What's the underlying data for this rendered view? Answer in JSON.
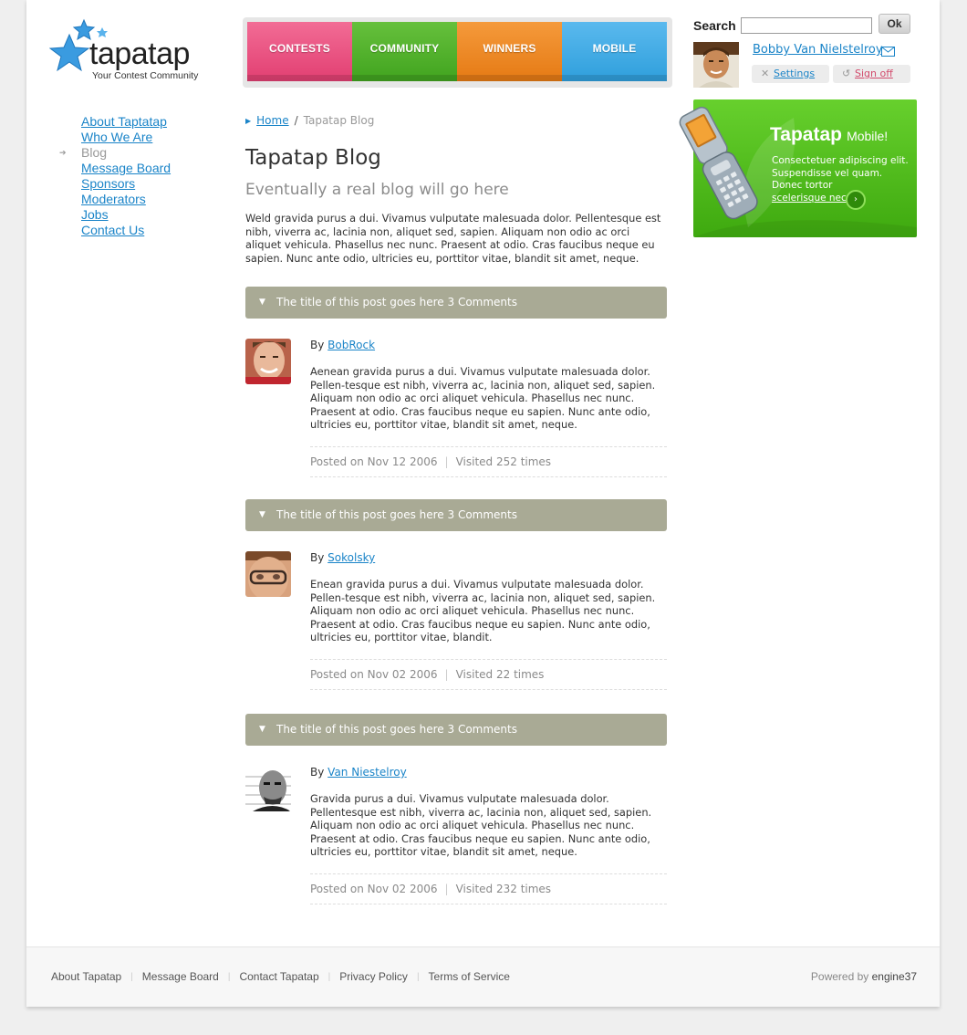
{
  "logo": {
    "word": "tapatap",
    "tagline": "Your Contest Community"
  },
  "nav": {
    "tabs": [
      {
        "label": "CONTESTS",
        "color": "#e8497b"
      },
      {
        "label": "COMMUNITY",
        "color": "#4fb02a"
      },
      {
        "label": "WINNERS",
        "color": "#ee8a23"
      },
      {
        "label": "MOBILE",
        "color": "#3aa8e4"
      }
    ]
  },
  "search": {
    "label": "Search",
    "value": "",
    "button": "Ok"
  },
  "user": {
    "name": "Bobby Van Nielstelroy",
    "settings": "Settings",
    "signoff": "Sign off"
  },
  "sidebar": {
    "items": [
      {
        "label": "About Taptatap"
      },
      {
        "label": "Who We Are"
      },
      {
        "label": "Blog",
        "current": true
      },
      {
        "label": "Message Board"
      },
      {
        "label": "Sponsors"
      },
      {
        "label": "Moderators"
      },
      {
        "label": "Jobs"
      },
      {
        "label": "Contact Us"
      }
    ]
  },
  "breadcrumb": {
    "home": "Home",
    "separator": "/",
    "current": "Tapatap Blog"
  },
  "main": {
    "title": "Tapatap Blog",
    "subtitle": "Eventually a real blog will go here",
    "intro": "Weld gravida purus a dui. Vivamus vulputate malesuada dolor. Pellentesque est nibh, viverra ac, lacinia non, aliquet sed, sapien. Aliquam non odio ac orci aliquet vehicula. Phasellus nec nunc. Praesent at odio. Cras faucibus neque eu sapien. Nunc ante odio, ultricies eu, porttitor vitae, blandit sit amet, neque."
  },
  "posts": [
    {
      "title": "The title of this post goes here 3 Comments",
      "by_prefix": "By",
      "author": "BobRock",
      "body": "Aenean gravida purus a dui. Vivamus vulputate malesuada dolor. Pellen-tesque est nibh, viverra ac, lacinia non, aliquet sed, sapien. Aliquam non odio ac orci aliquet vehicula. Phasellus nec nunc. Praesent at odio. Cras faucibus neque eu sapien. Nunc ante odio, ultricies eu, porttitor vitae, blandit sit amet, neque.",
      "posted": "Posted on Nov 12 2006",
      "visited": "Visited 252 times"
    },
    {
      "title": "The title of this post goes here 3 Comments",
      "by_prefix": "By",
      "author": "Sokolsky",
      "body": "Enean gravida purus a dui. Vivamus vulputate malesuada dolor. Pellen-tesque est nibh, viverra ac, lacinia non, aliquet sed, sapien. Aliquam non odio ac orci aliquet vehicula. Phasellus nec nunc. Praesent at odio. Cras faucibus neque eu sapien. Nunc ante odio, ultricies eu, porttitor vitae, blandit.",
      "posted": "Posted on Nov 02 2006",
      "visited": "Visited 22 times"
    },
    {
      "title": "The title of this post goes here 3 Comments",
      "by_prefix": "By",
      "author": "Van Niestelroy",
      "body": "Gravida purus a dui. Vivamus vulputate malesuada dolor. Pellentesque est nibh, viverra ac, lacinia non, aliquet sed, sapien. Aliquam non odio ac orci aliquet vehicula. Phasellus nec nunc. Praesent at odio. Cras faucibus neque eu sapien. Nunc ante odio, ultricies eu, porttitor vitae, blandit sit amet, neque.",
      "posted": "Posted on Nov 02 2006",
      "visited": "Visited 232 times"
    }
  ],
  "promo": {
    "brand": "Tapatap",
    "suffix": "Mobile!",
    "text": "Consectetuer adipiscing elit. Suspendisse vel quam. Donec tortor",
    "link": "scelerisque nec",
    "color": "#52bf1f"
  },
  "footer": {
    "links": [
      "About Tapatap",
      "Message Board",
      "Contact Tapatap",
      "Privacy Policy",
      "Terms of Service"
    ],
    "powered_prefix": "Powered by",
    "powered_brand": "engine37"
  },
  "icons": [
    "star-logo-icon",
    "mail-icon",
    "settings-x-icon",
    "signoff-icon",
    "triangle-down-icon",
    "arrow-right-icon",
    "go-arrow-icon",
    "phone-image"
  ]
}
